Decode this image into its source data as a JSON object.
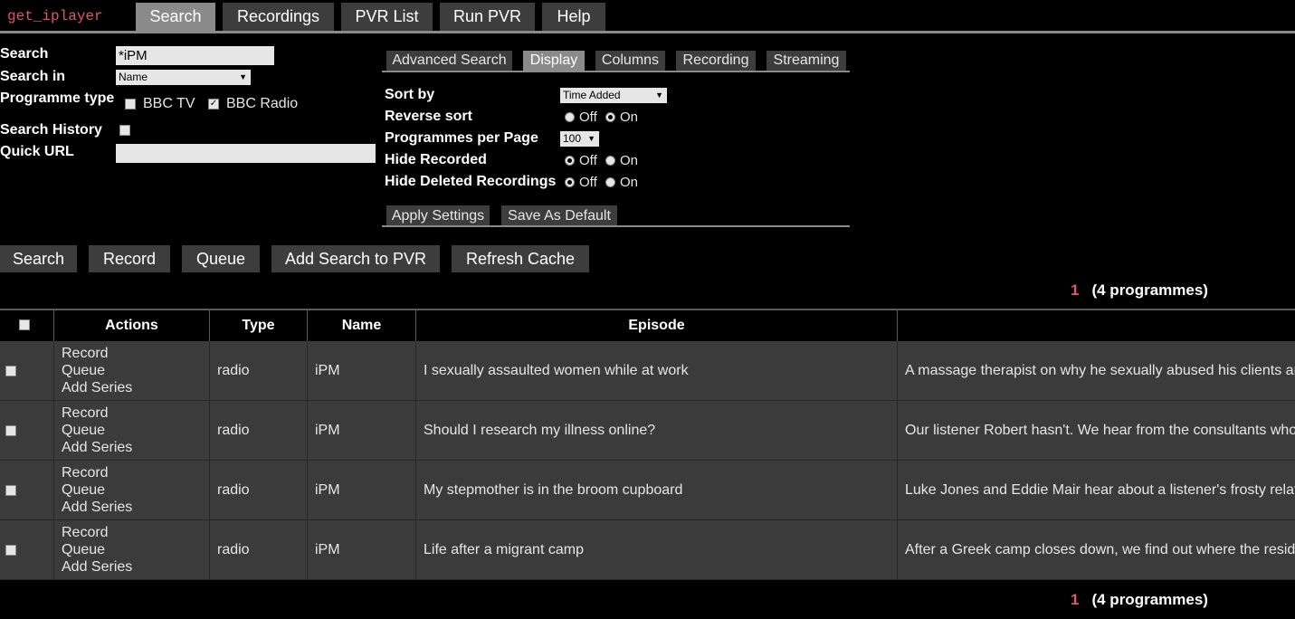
{
  "app": {
    "logo": "get_iplayer"
  },
  "nav": {
    "tabs": [
      {
        "label": "Search"
      },
      {
        "label": "Recordings"
      },
      {
        "label": "PVR List"
      },
      {
        "label": "Run PVR"
      },
      {
        "label": "Help"
      }
    ]
  },
  "form": {
    "search_label": "Search",
    "search_value": "*iPM",
    "searchin_label": "Search in",
    "searchin_value": "Name",
    "progtype_label": "Programme type",
    "bbctv_label": "BBC TV",
    "bbctv_checked": false,
    "bbcradio_label": "BBC Radio",
    "bbcradio_checked": true,
    "history_label": "Search History",
    "history_checked": false,
    "quickurl_label": "Quick URL",
    "quickurl_value": ""
  },
  "settings": {
    "tabs": [
      {
        "label": "Advanced Search"
      },
      {
        "label": "Display"
      },
      {
        "label": "Columns"
      },
      {
        "label": "Recording"
      },
      {
        "label": "Streaming"
      }
    ],
    "active_tab": "Display",
    "sortby_label": "Sort by",
    "sortby_value": "Time Added",
    "reverse_label": "Reverse sort",
    "perpage_label": "Programmes per Page",
    "perpage_value": "100",
    "hiderec_label": "Hide Recorded",
    "hidedel_label": "Hide Deleted Recordings",
    "off_label": "Off",
    "on_label": "On",
    "reverse_sort": "On",
    "hide_recorded": "Off",
    "hide_deleted": "Off",
    "apply_label": "Apply Settings",
    "default_label": "Save As Default"
  },
  "actions": {
    "search": "Search",
    "record": "Record",
    "queue": "Queue",
    "addpvr": "Add Search to PVR",
    "refresh": "Refresh Cache"
  },
  "pager": {
    "page": "1",
    "summary": "(4 programmes)"
  },
  "table": {
    "headers": {
      "actions": "Actions",
      "type": "Type",
      "name": "Name",
      "episode": "Episode",
      "desc": ""
    },
    "action_labels": {
      "record": "Record",
      "queue": "Queue",
      "add_series": "Add Series"
    },
    "rows": [
      {
        "type": "radio",
        "name": "iPM",
        "episode": "I sexually assaulted women while at work",
        "desc": "A massage therapist on why he sexually abused his clients and"
      },
      {
        "type": "radio",
        "name": "iPM",
        "episode": "Should I research my illness online?",
        "desc": "Our listener Robert hasn't. We hear from the consultants who to"
      },
      {
        "type": "radio",
        "name": "iPM",
        "episode": "My stepmother is in the broom cupboard",
        "desc": "Luke Jones and Eddie Mair hear about a listener's frosty relatio"
      },
      {
        "type": "radio",
        "name": "iPM",
        "episode": "Life after a migrant camp",
        "desc": "After a Greek camp closes down, we find out where the residen"
      }
    ]
  }
}
